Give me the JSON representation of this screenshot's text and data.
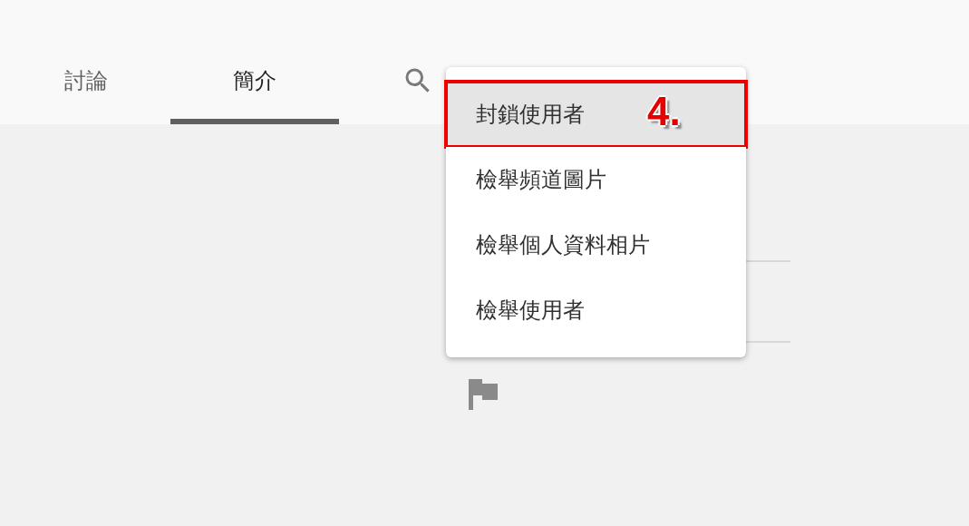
{
  "tabs": [
    {
      "label": "討論",
      "selected": false
    },
    {
      "label": "簡介",
      "selected": true
    }
  ],
  "menu": {
    "items": [
      {
        "label": "封鎖使用者",
        "selected": true,
        "callout": "4."
      },
      {
        "label": "檢舉頻道圖片",
        "selected": false
      },
      {
        "label": "檢舉個人資料相片",
        "selected": false
      },
      {
        "label": "檢舉使用者",
        "selected": false
      }
    ]
  }
}
